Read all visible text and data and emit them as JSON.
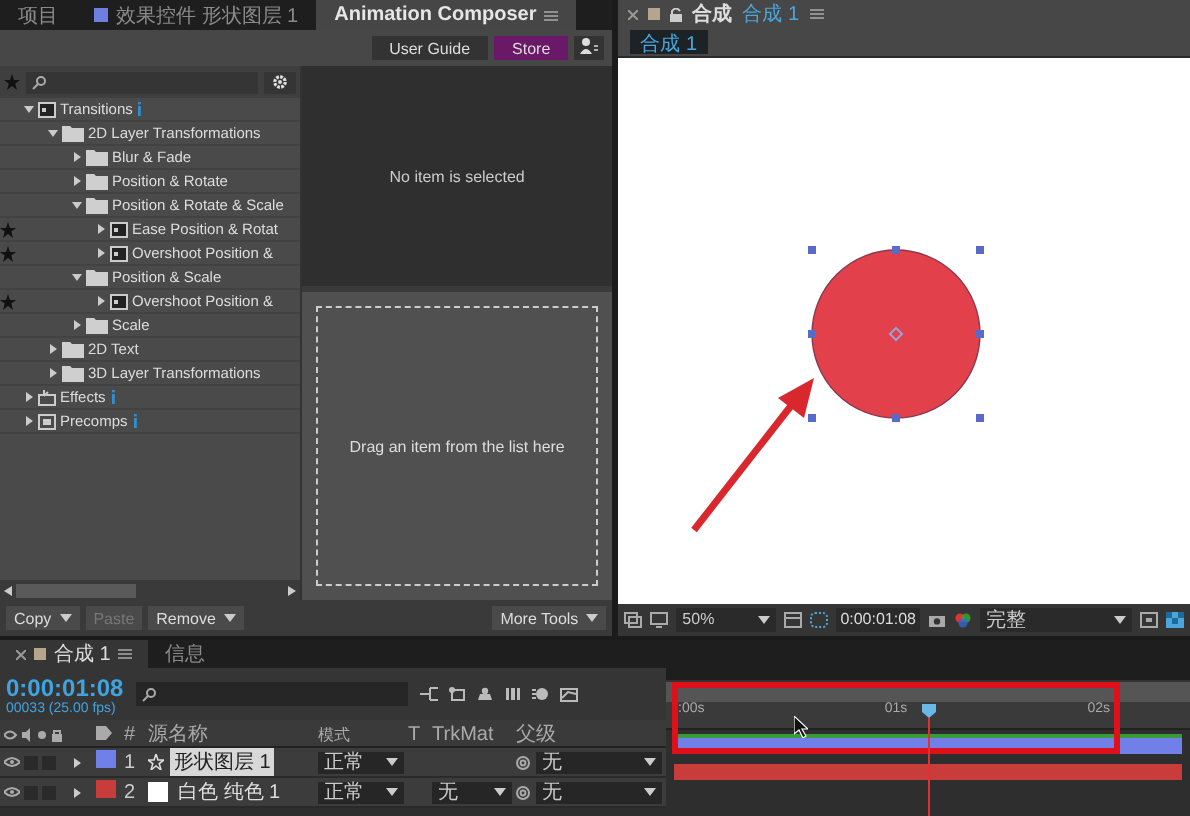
{
  "panel_tabs": [
    {
      "label": "项目",
      "selected": false
    },
    {
      "label": "效果控件 形状图层 1",
      "selected": false
    },
    {
      "label": "Animation Composer",
      "selected": true
    }
  ],
  "composer_buttons": [
    {
      "label": "User Guide",
      "kind": "plain"
    },
    {
      "label": "Store",
      "kind": "accent"
    }
  ],
  "tree": [
    {
      "label": "Transitions",
      "kind": "preset",
      "info": true,
      "starred": false,
      "expanded": true,
      "children": [
        {
          "label": "2D Layer Transformations",
          "kind": "folder",
          "info": false,
          "starred": false,
          "expanded": true,
          "children": [
            {
              "label": "Blur & Fade",
              "kind": "folder",
              "info": false,
              "starred": false,
              "expanded": false
            },
            {
              "label": "Position & Rotate",
              "kind": "folder",
              "info": false,
              "starred": false,
              "expanded": false
            },
            {
              "label": "Position & Rotate & Scale",
              "kind": "folder",
              "info": false,
              "starred": false,
              "expanded": true,
              "children": [
                {
                  "label": "Ease Position & Rotat",
                  "kind": "preset",
                  "info": false,
                  "starred": true,
                  "expanded": false
                },
                {
                  "label": "Overshoot Position &",
                  "kind": "preset",
                  "info": false,
                  "starred": true,
                  "expanded": false
                }
              ]
            },
            {
              "label": "Position & Scale",
              "kind": "folder",
              "info": false,
              "starred": false,
              "expanded": true,
              "children": [
                {
                  "label": "Overshoot Position &",
                  "kind": "preset",
                  "info": false,
                  "starred": true,
                  "expanded": false
                }
              ]
            },
            {
              "label": "Scale",
              "kind": "folder",
              "info": false,
              "starred": false,
              "expanded": false
            }
          ]
        },
        {
          "label": "2D Text",
          "kind": "folder",
          "info": false,
          "starred": false,
          "expanded": false
        },
        {
          "label": "3D Layer Transformations",
          "kind": "folder",
          "info": false,
          "starred": false,
          "expanded": false
        }
      ]
    },
    {
      "label": "Effects",
      "kind": "effects",
      "info": true,
      "starred": false,
      "expanded": false
    },
    {
      "label": "Precomps",
      "kind": "precomps",
      "info": true,
      "starred": false,
      "expanded": false
    }
  ],
  "detail_message": "No item is selected",
  "drop_zone": "Drag an item from the list here",
  "actions": [
    {
      "label": "Copy",
      "dropdown": true,
      "disabled": false
    },
    {
      "label": "Paste",
      "dropdown": false,
      "disabled": true
    },
    {
      "label": "Remove",
      "dropdown": true,
      "disabled": false
    },
    {
      "label": "More Tools",
      "dropdown": true,
      "disabled": false
    }
  ],
  "viewer": {
    "tab_prefix": "合成",
    "tab_name": "合成 1",
    "comp_button": "合成 1",
    "zoom": "50%",
    "timecode": "0:00:01:08",
    "resolution": "完整"
  },
  "timeline": {
    "tabs": [
      {
        "label": "合成 1",
        "selected": true
      },
      {
        "label": "信息",
        "selected": false
      }
    ],
    "timecode": "0:00:01:08",
    "frame_info": "00033 (25.00 fps)",
    "columns": [
      "#",
      "源名称",
      "模式",
      "T",
      "TrkMat",
      "父级"
    ],
    "layers": [
      {
        "number": "1",
        "name": "形状图层 1",
        "kind": "shape",
        "color": "#7080e8",
        "mode": "正常",
        "parent": "无",
        "selected": true
      },
      {
        "number": "2",
        "name": "白色 纯色 1",
        "kind": "solid",
        "color": "#c83c3c",
        "mode": "正常",
        "trkmat": "无",
        "parent": "无",
        "selected": false
      }
    ],
    "ruler": [
      ":00s",
      "01s",
      "02s"
    ]
  }
}
